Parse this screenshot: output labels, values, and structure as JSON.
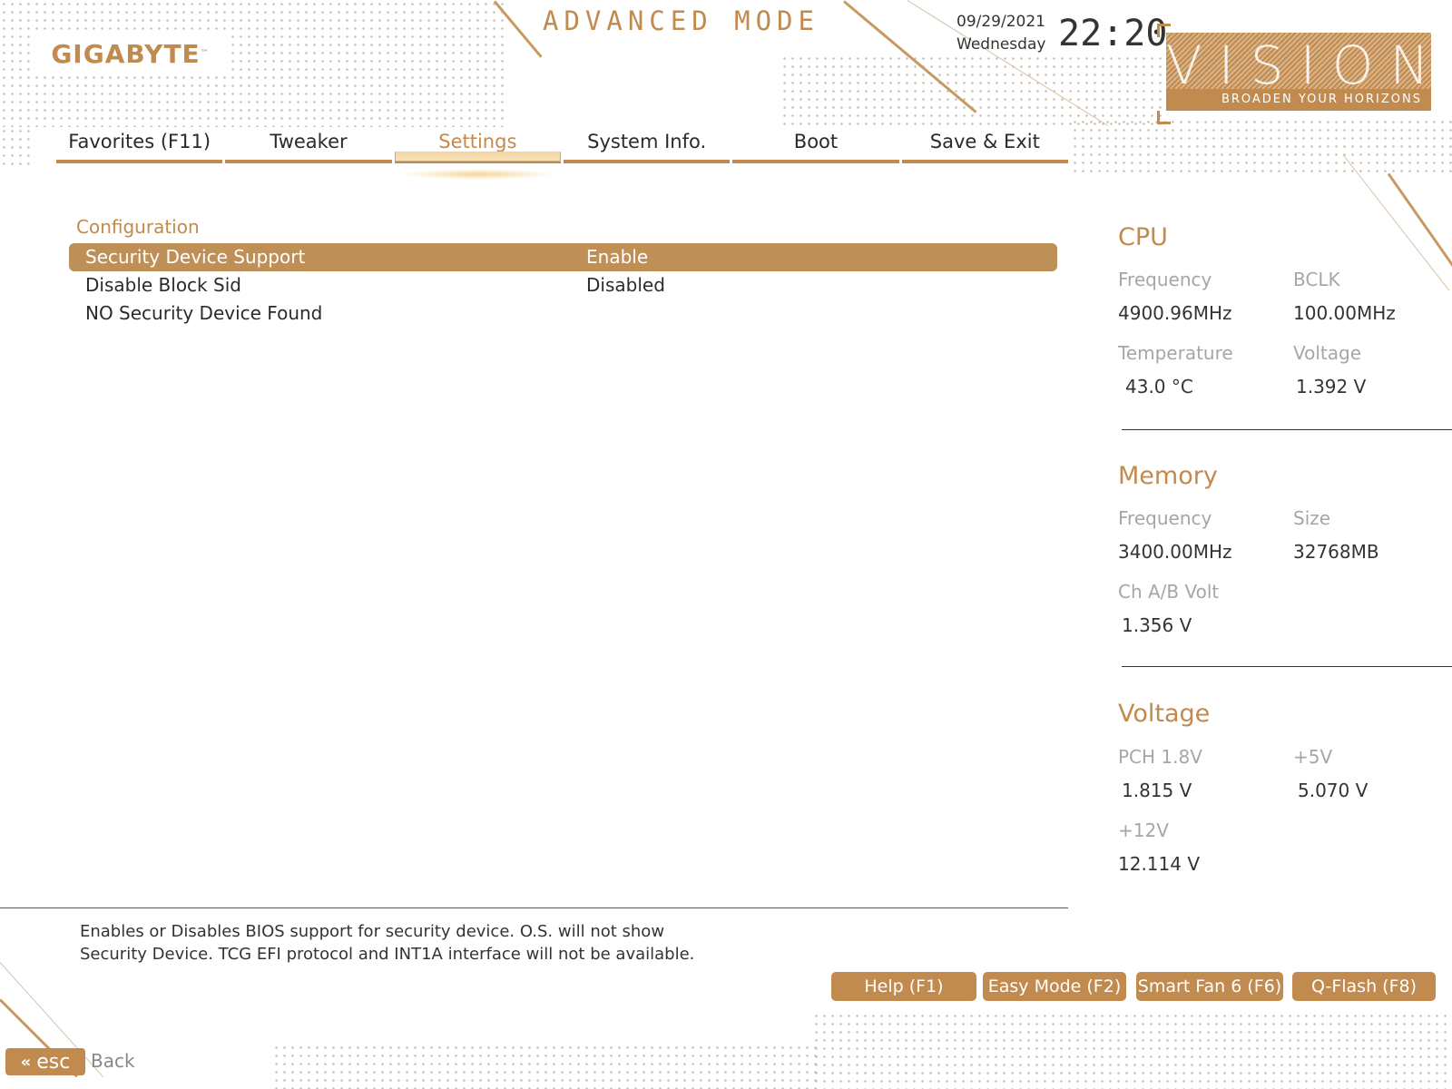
{
  "header": {
    "brand": "GIGABYTE",
    "brand_mark": "™",
    "mode_title": "ADVANCED MODE",
    "date": "09/29/2021",
    "weekday": "Wednesday",
    "time": "22:20",
    "series_logo": "VISION",
    "series_tagline": "BROADEN YOUR HORIZONS"
  },
  "tabs": [
    {
      "label": "Favorites (F11)"
    },
    {
      "label": "Tweaker"
    },
    {
      "label": "Settings"
    },
    {
      "label": "System Info."
    },
    {
      "label": "Boot"
    },
    {
      "label": "Save & Exit"
    }
  ],
  "active_tab": "Settings",
  "main": {
    "section_title": "Configuration",
    "rows": [
      {
        "label": "Security Device Support",
        "value": "Enable"
      },
      {
        "label": "Disable Block Sid",
        "value": "Disabled"
      },
      {
        "label": "NO Security Device Found",
        "value": ""
      }
    ]
  },
  "monitor": {
    "cpu": {
      "title": "CPU",
      "frequency_label": "Frequency",
      "frequency": "4900.96MHz",
      "bclk_label": "BCLK",
      "bclk": "100.00MHz",
      "temperature_label": "Temperature",
      "temperature": "43.0 °C",
      "voltage_label": "Voltage",
      "voltage": "1.392 V"
    },
    "memory": {
      "title": "Memory",
      "frequency_label": "Frequency",
      "frequency": "3400.00MHz",
      "size_label": "Size",
      "size": "32768MB",
      "volt_label": "Ch A/B Volt",
      "volt": "1.356 V"
    },
    "voltage": {
      "title": "Voltage",
      "pch_label": "PCH 1.8V",
      "pch": "1.815 V",
      "v5_label": "+5V",
      "v5": "5.070 V",
      "v12_label": "+12V",
      "v12": "12.114 V"
    }
  },
  "help": {
    "line1": "Enables or Disables BIOS support for security device. O.S. will not show",
    "line2": "Security Device. TCG EFI protocol and INT1A interface will not be available."
  },
  "footer": {
    "buttons": [
      {
        "label": "Help (F1)"
      },
      {
        "label": "Easy Mode (F2)"
      },
      {
        "label": "Smart Fan 6 (F6)"
      },
      {
        "label": "Q-Flash (F8)"
      }
    ],
    "esc_key": "esc",
    "back_label": "Back"
  },
  "colors": {
    "accent": "#c18a4f",
    "selected_row": "#bf8f58",
    "text": "#2b2b2b",
    "muted_label": "#a6a6a6"
  },
  "icons": [
    "double-chevron-left-icon"
  ]
}
